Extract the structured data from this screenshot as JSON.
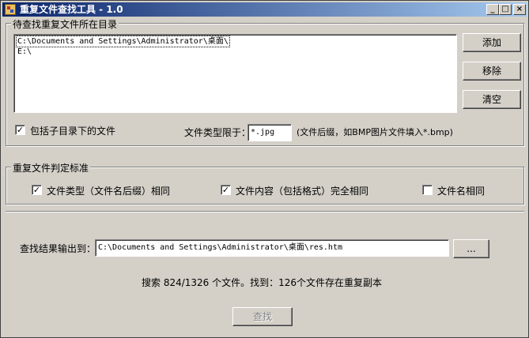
{
  "window": {
    "title": "重复文件查找工具 - 1.0",
    "controls": {
      "minimize": "_",
      "maximize": "□",
      "close": "×"
    }
  },
  "dir_group": {
    "legend": "待查找重复文件所在目录",
    "items": [
      "C:\\Documents and Settings\\Administrator\\桌面\\",
      "E:\\"
    ],
    "add_label": "添加",
    "remove_label": "移除",
    "clear_label": "清空",
    "include_subdirs_label": "包括子目录下的文件",
    "include_subdirs_checked": "✓",
    "filetype_label": "文件类型限于：",
    "filetype_value": "*.jpg",
    "filetype_hint": "(文件后缀，如BMP图片文件填入*.bmp)"
  },
  "criteria_group": {
    "legend": "重复文件判定标准",
    "opt_type_label": "文件类型（文件名后缀）相同",
    "opt_type_checked": "✓",
    "opt_content_label": "文件内容（包括格式）完全相同",
    "opt_content_checked": "✓",
    "opt_name_label": "文件名相同",
    "opt_name_checked": ""
  },
  "output": {
    "label": "查找结果输出到：",
    "path": "C:\\Documents and Settings\\Administrator\\桌面\\res.htm",
    "browse_label": "..."
  },
  "status": {
    "text": "搜索 824/1326 个文件。找到：126个文件存在重复副本"
  },
  "search_button": {
    "label": "查找",
    "enabled": false
  }
}
